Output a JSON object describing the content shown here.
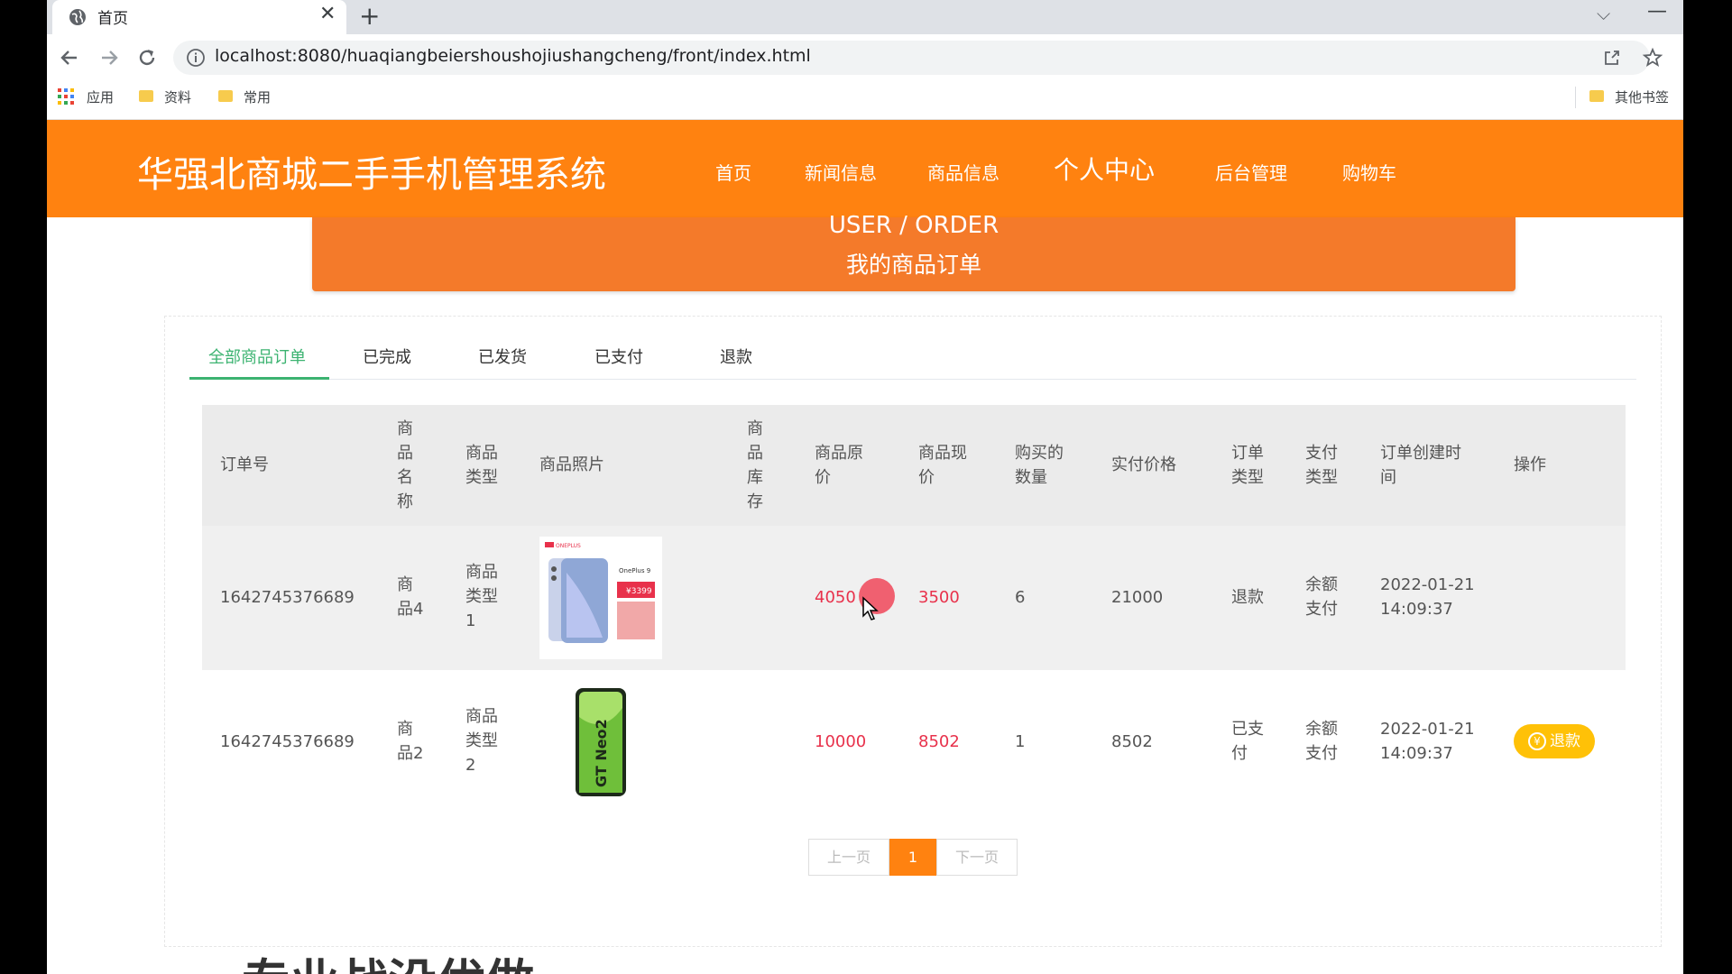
{
  "browser": {
    "tab_title": "首页",
    "close_glyph": "✕",
    "new_tab_glyph": "+",
    "url": "localhost:8080/huaqiangbeiershoushojiushangcheng/front/index.html",
    "bookmarks": [
      "应用",
      "资料",
      "常用"
    ],
    "other_bookmarks": "其他书签"
  },
  "site": {
    "title": "华强北商城二手手机管理系统",
    "nav": [
      "首页",
      "新闻信息",
      "商品信息",
      "个人中心",
      "后台管理",
      "购物车"
    ],
    "nav_active": "个人中心",
    "brand_color": "#ff8210"
  },
  "banner": {
    "en": "USER / ORDER",
    "zh": "我的商品订单"
  },
  "order_tabs": {
    "items": [
      "全部商品订单",
      "已完成",
      "已发货",
      "已支付",
      "退款"
    ],
    "active": "全部商品订单"
  },
  "table": {
    "headers": {
      "order_no": "订单号",
      "name": [
        "商",
        "品",
        "名",
        "称"
      ],
      "type": [
        "商品",
        "类型"
      ],
      "photo": "商品照片",
      "stock": [
        "商",
        "品",
        "库",
        "存"
      ],
      "orig_price": [
        "商品原",
        "价"
      ],
      "cur_price": [
        "商品现",
        "价"
      ],
      "qty": [
        "购买的",
        "数量"
      ],
      "paid": "实付价格",
      "order_type": [
        "订单",
        "类型"
      ],
      "pay_type": [
        "支付",
        "类型"
      ],
      "created": [
        "订单创建时",
        "间"
      ],
      "action": "操作"
    },
    "rows": [
      {
        "order_no": "1642745376689",
        "name": [
          "商",
          "品4"
        ],
        "type": [
          "商品",
          "类型",
          "1"
        ],
        "photo_brand": "ONEPLUS",
        "photo_model": "OnePlus 9",
        "photo_price": "¥3399",
        "stock": "",
        "orig_price": "4050",
        "cur_price": "3500",
        "qty": "6",
        "paid": "21000",
        "order_type": [
          "退款"
        ],
        "pay_type": [
          "余额",
          "支付"
        ],
        "created": [
          "2022-01-21",
          "14:09:37"
        ],
        "action": ""
      },
      {
        "order_no": "1642745376689",
        "name": [
          "商",
          "品2"
        ],
        "type": [
          "商品",
          "类型",
          "2"
        ],
        "photo_model": "GT Neo2",
        "stock": "",
        "orig_price": "10000",
        "cur_price": "8502",
        "qty": "1",
        "paid": "8502",
        "order_type": [
          "已支",
          "付"
        ],
        "pay_type": [
          "余额",
          "支付"
        ],
        "created": [
          "2022-01-21",
          "14:09:37"
        ],
        "action": "退款"
      }
    ]
  },
  "pager": {
    "prev": "上一页",
    "current": "1",
    "next": "下一页"
  },
  "footer_heading_partial": "专业战没优做"
}
